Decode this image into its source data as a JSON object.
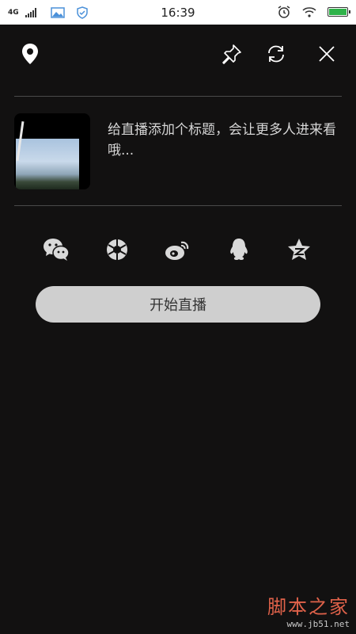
{
  "status_bar": {
    "network": "4G",
    "time": "16:39"
  },
  "toolbar": {
    "location_icon": "map-pin-icon",
    "pin_icon": "pin-icon",
    "refresh_icon": "refresh-icon",
    "close_icon": "close-icon"
  },
  "title_area": {
    "placeholder": "给直播添加个标题，会让更多人进来看哦..."
  },
  "share": {
    "items": [
      {
        "icon": "wechat-icon"
      },
      {
        "icon": "moments-icon"
      },
      {
        "icon": "weibo-icon"
      },
      {
        "icon": "qq-icon"
      },
      {
        "icon": "qzone-icon"
      }
    ]
  },
  "start_button": {
    "label": "开始直播"
  },
  "watermark": {
    "main": "脚本之家",
    "sub": "www.jb51.net"
  },
  "colors": {
    "background": "#121111",
    "button_bg": "#cfcfcf",
    "battery": "#2fb34a",
    "watermark": "#e0624a"
  }
}
